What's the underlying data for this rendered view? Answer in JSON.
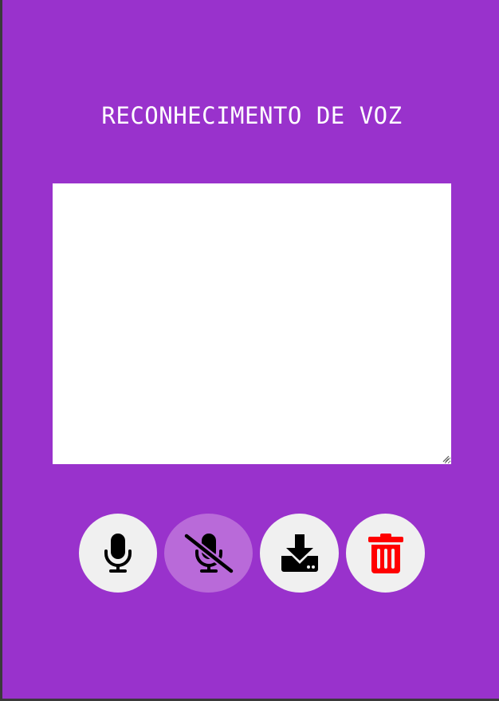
{
  "page": {
    "title": "RECONHECIMENTO DE VOZ"
  },
  "transcript": {
    "value": "",
    "placeholder": ""
  },
  "controls": [
    {
      "action": "start-recording",
      "icon": "microphone-icon",
      "state": "idle"
    },
    {
      "action": "stop-recording",
      "icon": "microphone-slash-icon",
      "state": "active"
    },
    {
      "action": "download",
      "icon": "download-icon",
      "state": "idle"
    },
    {
      "action": "clear",
      "icon": "trash-icon",
      "state": "idle"
    }
  ],
  "colors": {
    "background": "#9932cc",
    "title_text": "#ffffff",
    "button_background": "#f0f0f0",
    "active_button_background": "#b96ad9",
    "icon_default": "#000000",
    "delete_icon": "#ff0000"
  }
}
